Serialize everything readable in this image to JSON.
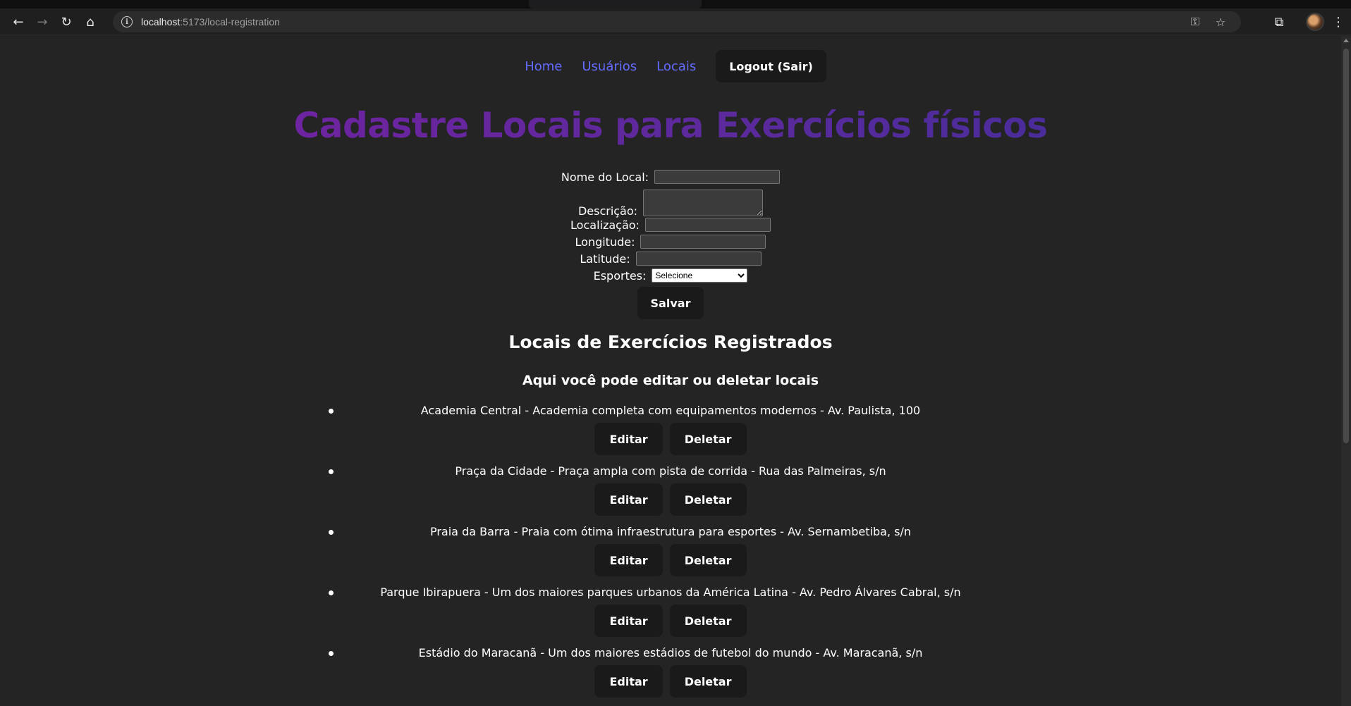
{
  "browser": {
    "url_host": "localhost",
    "url_path": ":5173/local-registration"
  },
  "nav": {
    "home": "Home",
    "usuarios": "Usuários",
    "locais": "Locais",
    "logout": "Logout (Sair)"
  },
  "page": {
    "title": "Cadastre Locais para Exercícios físicos"
  },
  "form": {
    "nome_label": "Nome do Local:",
    "nome_value": "",
    "descricao_label": "Descrição:",
    "descricao_value": "",
    "localizacao_label": "Localização:",
    "localizacao_value": "",
    "longitude_label": "Longitude:",
    "longitude_value": "",
    "latitude_label": "Latitude:",
    "latitude_value": "",
    "esportes_label": "Esportes:",
    "esportes_selected": "Selecione",
    "save_label": "Salvar"
  },
  "registered": {
    "heading": "Locais de Exercícios Registrados",
    "subheading": "Aqui você pode editar ou deletar locais",
    "edit_label": "Editar",
    "delete_label": "Deletar",
    "items": [
      {
        "text": "Academia Central - Academia completa com equipamentos modernos - Av. Paulista, 100"
      },
      {
        "text": "Praça da Cidade - Praça ampla com pista de corrida - Rua das Palmeiras, s/n"
      },
      {
        "text": "Praia da Barra - Praia com ótima infraestrutura para esportes - Av. Sernambetiba, s/n"
      },
      {
        "text": "Parque Ibirapuera - Um dos maiores parques urbanos da América Latina - Av. Pedro Álvares Cabral, s/n"
      },
      {
        "text": "Estádio do Maracanã - Um dos maiores estádios de futebol do mundo - Av. Maracanã, s/n"
      }
    ]
  },
  "colors": {
    "background": "#242424",
    "link": "#646cff",
    "title_gradient_start": "#7a1fa2",
    "title_gradient_end": "#3b2e9a",
    "button_bg": "#1a1a1a"
  }
}
